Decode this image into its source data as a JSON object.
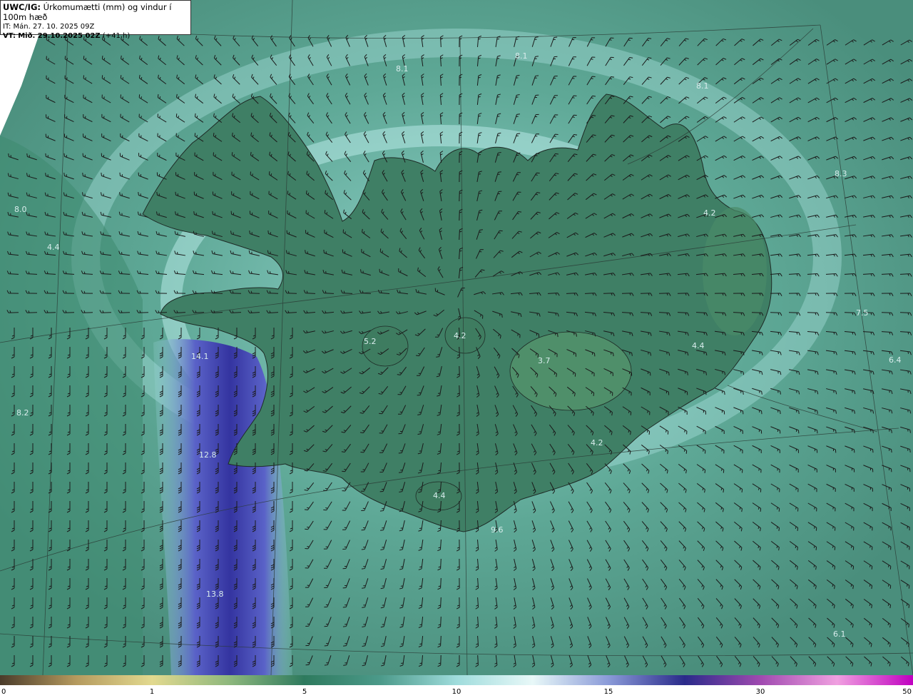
{
  "header": {
    "model": "UWC/IG:",
    "title": "Úrkomumætti (mm) og vindur í 100m hæð",
    "it_label": "IT:",
    "it_value": "Mán. 27. 10. 2025 09Z",
    "vt_label": "VT:",
    "vt_value": "Mið. 29.10.2025 02Z",
    "vt_offset": "(+41 h)"
  },
  "colorbar": {
    "ticks": [
      "0",
      "1",
      "5",
      "10",
      "15",
      "30",
      "50"
    ],
    "colors": [
      "#4a3b2a",
      "#b59a5e",
      "#e2d98f",
      "#8fb87d",
      "#2e7a5e",
      "#4c9a8a",
      "#9fdcdc",
      "#e8f8f8",
      "#8a9ad8",
      "#2a2a8a",
      "#a04ab0",
      "#f0a0e0",
      "#c000c0"
    ]
  },
  "map": {
    "sea_color": "#4f9483",
    "land_color": "#3f7f65",
    "band_color": "#3a3aa8",
    "value_labels": [
      {
        "text": "8.1"
      },
      {
        "text": "8.1"
      },
      {
        "text": "8.1"
      },
      {
        "text": "8.3"
      },
      {
        "text": "8.0"
      },
      {
        "text": "4.4"
      },
      {
        "text": "4.2"
      },
      {
        "text": "5.2"
      },
      {
        "text": "4.2"
      },
      {
        "text": "3.7"
      },
      {
        "text": "4.4"
      },
      {
        "text": "7.5"
      },
      {
        "text": "6.4"
      },
      {
        "text": "14.1"
      },
      {
        "text": "8.2"
      },
      {
        "text": "12.8"
      },
      {
        "text": "4.2"
      },
      {
        "text": "4.4"
      },
      {
        "text": "9.6"
      },
      {
        "text": "13.8"
      },
      {
        "text": "6.1"
      }
    ]
  }
}
